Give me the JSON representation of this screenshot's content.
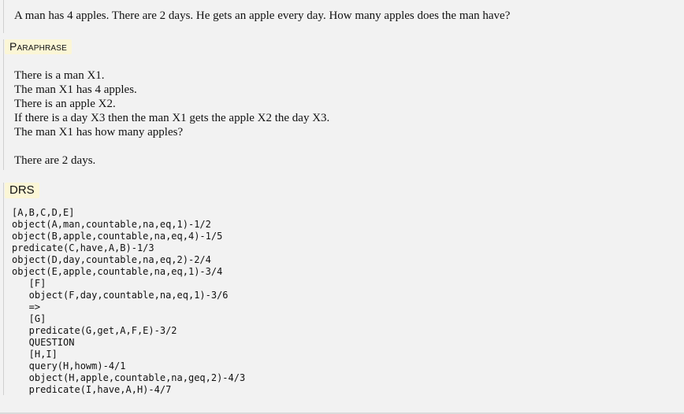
{
  "question": "A man has 4 apples. There are 2 days. He gets an apple every day. How many apples does the man have?",
  "paraphrase": {
    "label": "Paraphrase",
    "lines": [
      "There is a man X1.",
      "The man X1 has 4 apples.",
      "There is an apple X2.",
      "If there is a day X3 then the man X1 gets the apple X2 the day X3.",
      "The man X1 has how many apples?",
      "",
      "There are 2 days."
    ]
  },
  "drs": {
    "label": "DRS",
    "lines": [
      "[A,B,C,D,E]",
      "object(A,man,countable,na,eq,1)-1/2",
      "object(B,apple,countable,na,eq,4)-1/5",
      "predicate(C,have,A,B)-1/3",
      "object(D,day,countable,na,eq,2)-2/4",
      "object(E,apple,countable,na,eq,1)-3/4",
      "   [F]",
      "   object(F,day,countable,na,eq,1)-3/6",
      "   =>",
      "   [G]",
      "   predicate(G,get,A,F,E)-3/2",
      "   QUESTION",
      "   [H,I]",
      "   query(H,howm)-4/1",
      "   object(H,apple,countable,na,geq,2)-4/3",
      "   predicate(I,have,A,H)-4/7"
    ]
  }
}
